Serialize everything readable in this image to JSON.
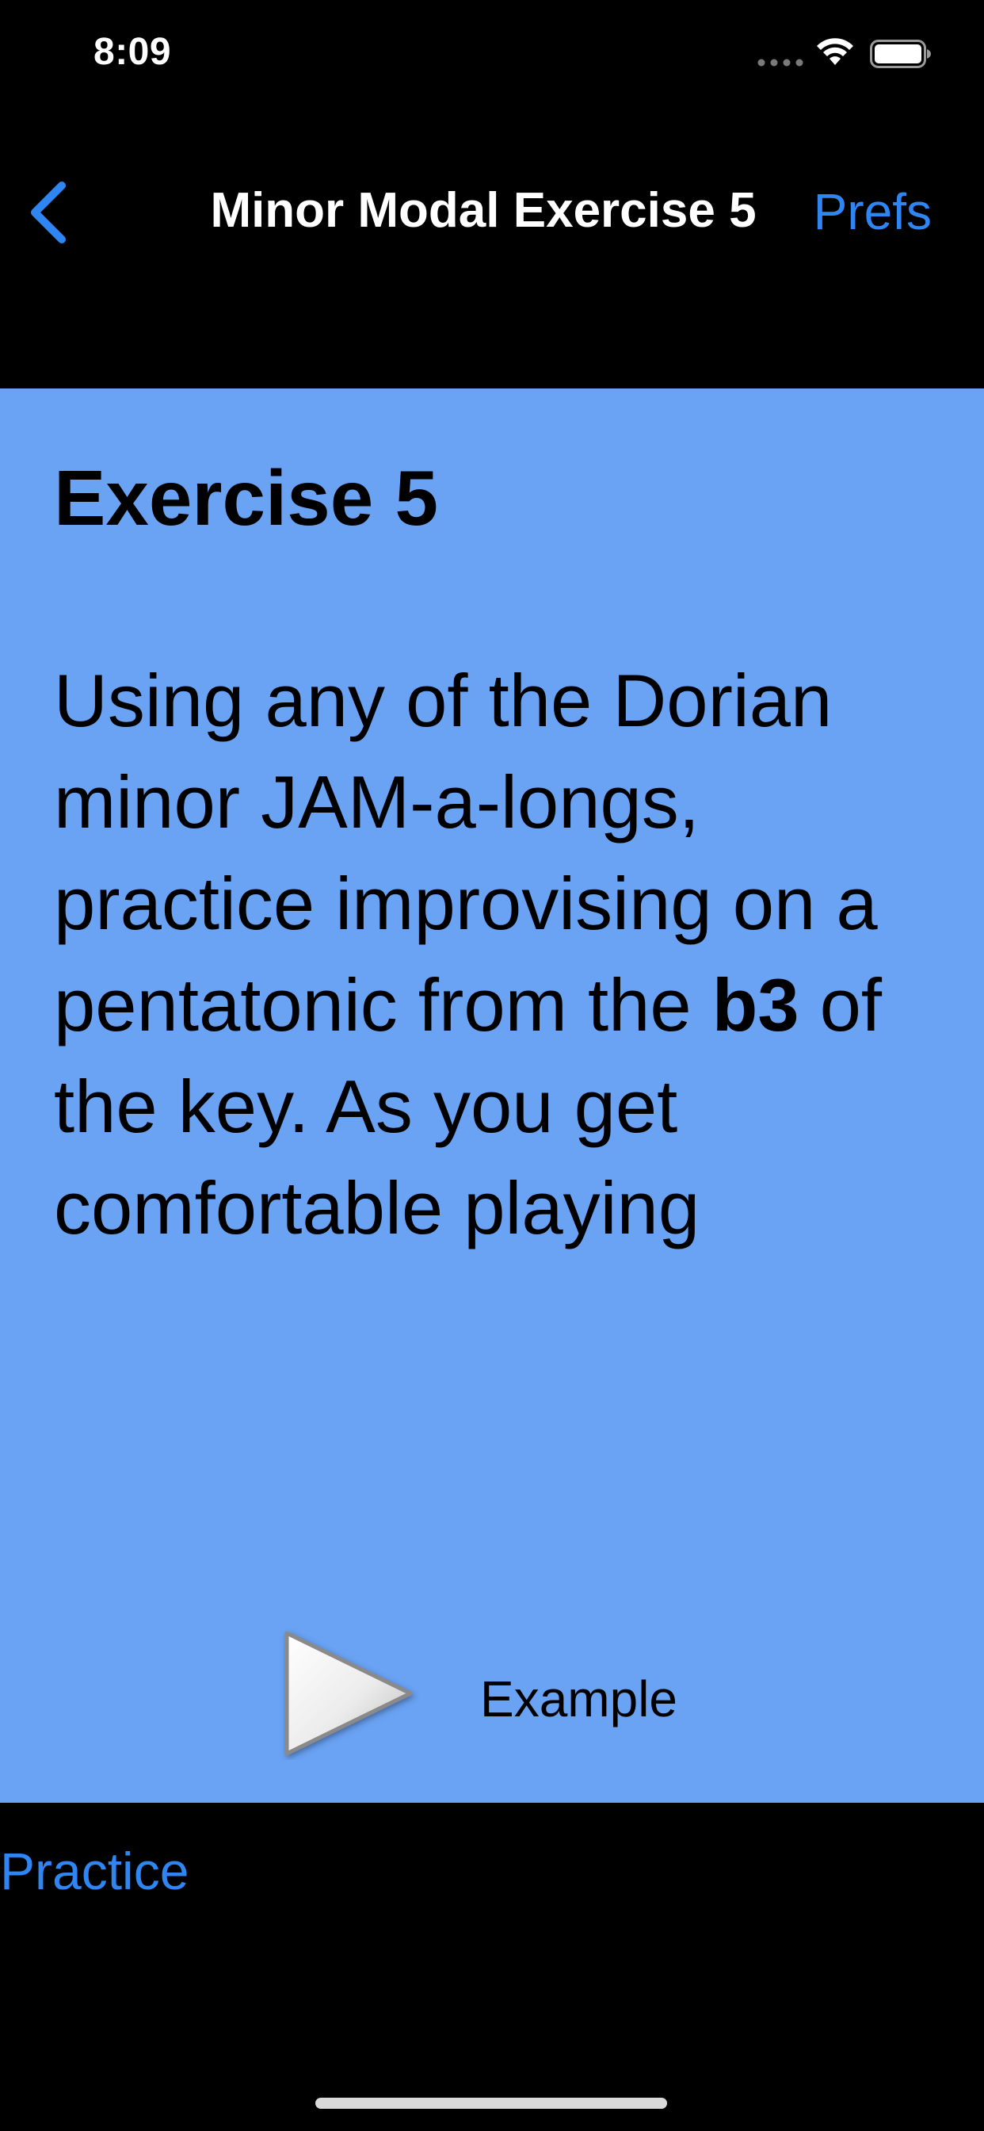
{
  "status_bar": {
    "time": "8:09",
    "icons": [
      "signal-dots-icon",
      "wifi-icon",
      "battery-icon"
    ]
  },
  "nav_bar": {
    "back_icon": "chevron-left-icon",
    "title": "Minor Modal Exercise 5",
    "prefs_label": "Prefs"
  },
  "content": {
    "heading": "Exercise 5",
    "body_part1": "Using any of the Dorian minor JAM-a-longs, practice improvising on a pentatonic from the ",
    "body_bold": "b3",
    "body_part2": " of the key. As you get comfortable playing",
    "play_icon": "play-icon",
    "example_label": "Example"
  },
  "bottom": {
    "practice_label": "Practice"
  },
  "colors": {
    "background": "#000000",
    "panel": "#6aa3f4",
    "accent": "#2f86f2",
    "nav_text": "#ffffff"
  }
}
